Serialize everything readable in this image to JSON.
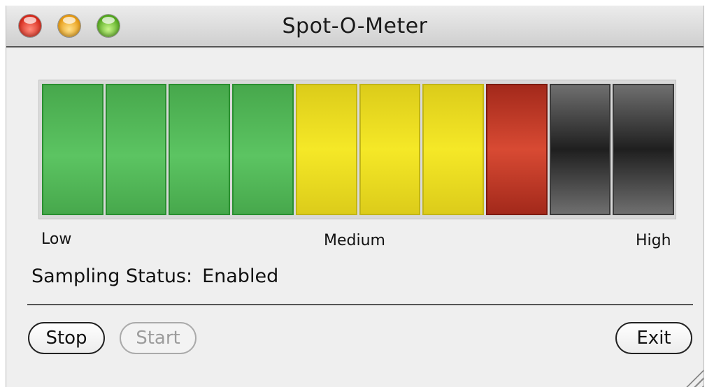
{
  "window": {
    "title": "Spot-O-Meter",
    "traffic_lights": [
      "close",
      "minimize",
      "zoom"
    ]
  },
  "meter": {
    "segments": [
      {
        "color": "#52b356",
        "lit": true
      },
      {
        "color": "#52b356",
        "lit": true
      },
      {
        "color": "#52b356",
        "lit": true
      },
      {
        "color": "#52b356",
        "lit": true
      },
      {
        "color": "#ecdd22",
        "lit": true
      },
      {
        "color": "#ecdd22",
        "lit": true
      },
      {
        "color": "#ecdd22",
        "lit": true
      },
      {
        "color": "#c33a26",
        "lit": true
      },
      {
        "color": "#3a3a3a",
        "lit": false
      },
      {
        "color": "#3a3a3a",
        "lit": false
      }
    ],
    "level_segments_lit": 8,
    "level_segments_total": 10,
    "labels": {
      "low": "Low",
      "medium": "Medium",
      "high": "High"
    }
  },
  "status": {
    "label": "Sampling Status:",
    "value": "Enabled"
  },
  "buttons": {
    "stop": "Stop",
    "start": "Start",
    "exit": "Exit"
  }
}
